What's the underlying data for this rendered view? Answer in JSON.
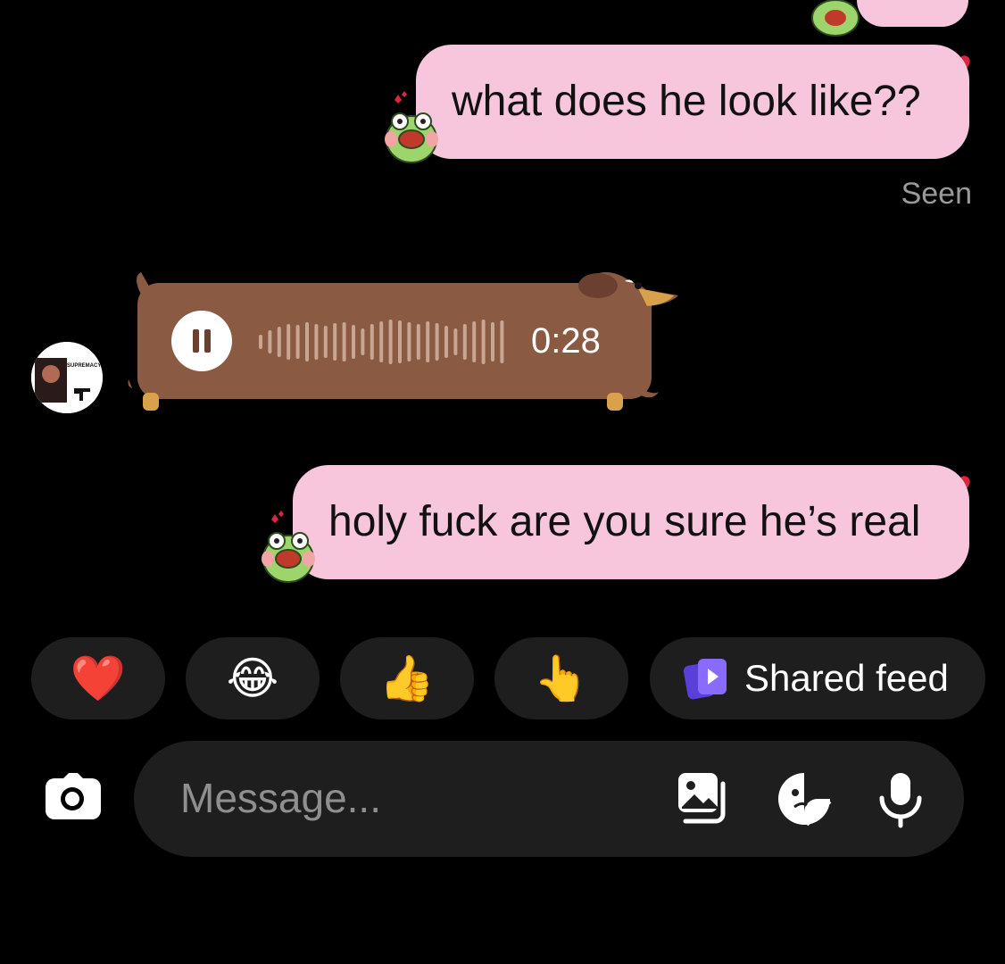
{
  "messages": [
    {
      "sender": "me",
      "text": "what does he look like??",
      "reaction": "heart"
    },
    {
      "sender": "other",
      "type": "voice",
      "duration": "0:28",
      "state": "playing"
    },
    {
      "sender": "me",
      "text": "holy fuck are you sure he’s real",
      "reaction": "heart"
    }
  ],
  "seen_label": "Seen",
  "avatar_text": "SUPREMACY",
  "quick_reactions": [
    {
      "name": "red-heart",
      "emoji": "❤️"
    },
    {
      "name": "tears-of-joy",
      "emoji": "😂"
    },
    {
      "name": "thumbs-up",
      "emoji": "👍"
    },
    {
      "name": "pointing-hand",
      "emoji": "👆"
    }
  ],
  "shared_feed_label": "Shared feed",
  "composer": {
    "placeholder": "Message...",
    "value": ""
  },
  "icons": {
    "camera": "camera-icon",
    "gallery": "gallery-icon",
    "sticker": "sticker-icon",
    "mic": "microphone-icon",
    "pause": "pause-icon",
    "shared_feed": "shared-feed-icon"
  },
  "colors": {
    "bubble": "#f7c6dd",
    "background": "#000000",
    "pill": "#1e1e1e",
    "voice_bubble": "#8a5a43",
    "heart": "#e0243f",
    "shared_feed_accent": "#7b5cff"
  }
}
